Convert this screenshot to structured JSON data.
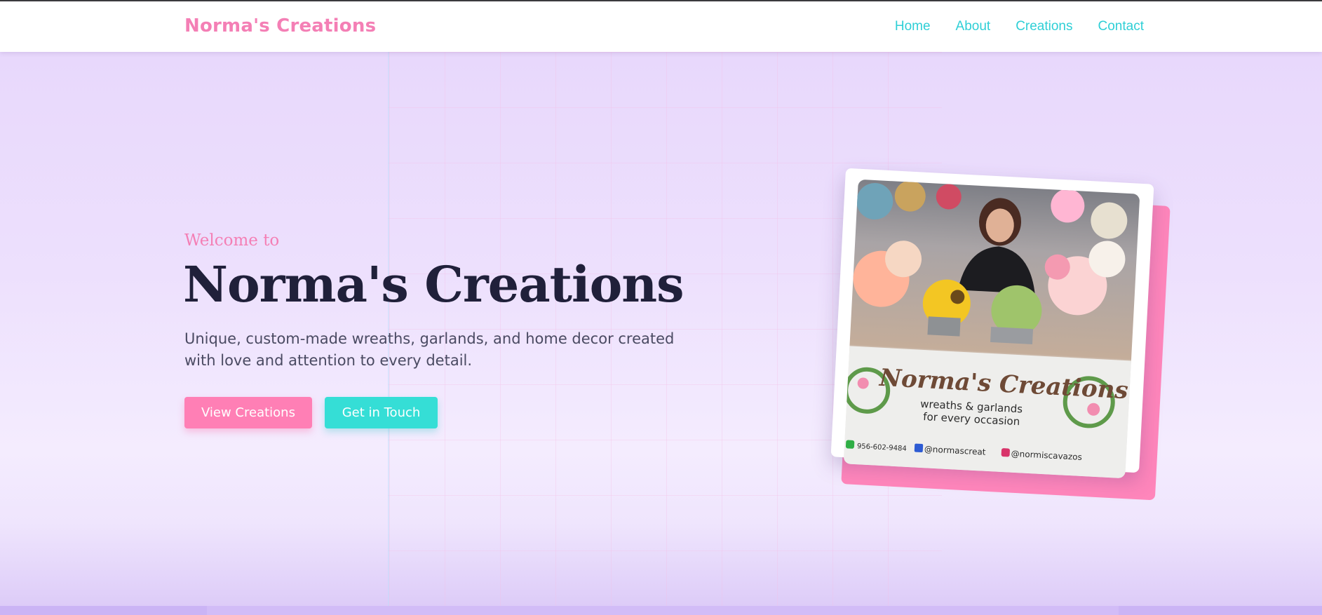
{
  "navbar": {
    "brand": "Norma's Creations",
    "links": [
      {
        "label": "Home"
      },
      {
        "label": "About"
      },
      {
        "label": "Creations"
      },
      {
        "label": "Contact"
      }
    ]
  },
  "hero": {
    "welcome": "Welcome to",
    "title": "Norma's Creations",
    "subtitle": "Unique, custom-made wreaths, garlands, and home decor created with love and attention to every detail.",
    "primary_button": "View Creations",
    "secondary_button": "Get in Touch"
  },
  "photo": {
    "banner_title": "Norma's Creations",
    "banner_tagline_1": "wreaths & garlands",
    "banner_tagline_2": "for every occasion",
    "phone": "956-602-9484",
    "facebook": "@normascreat",
    "instagram": "@normiscavazos"
  },
  "colors": {
    "brand_pink": "#f47fb5",
    "accent_teal": "#2fcfd6",
    "title_dark": "#20203a",
    "hero_background": "#ede0fd"
  }
}
